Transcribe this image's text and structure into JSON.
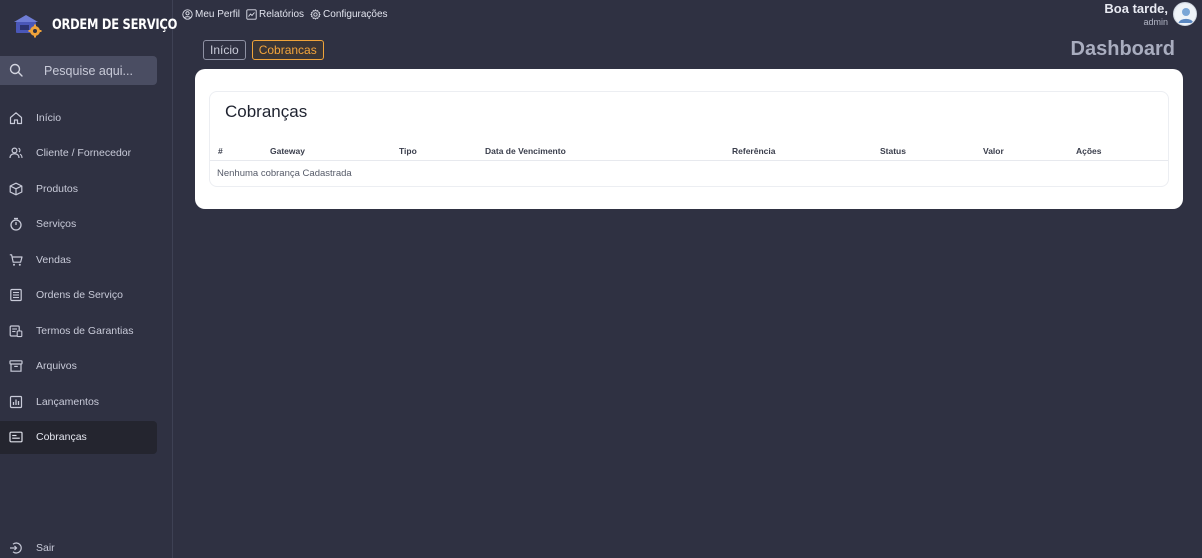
{
  "brand": {
    "title": "ORDEM DE SERVIÇO"
  },
  "search": {
    "placeholder": "Pesquise aqui..."
  },
  "sidebar": {
    "items": [
      {
        "label": "Início",
        "icon": "home-icon"
      },
      {
        "label": "Cliente / Fornecedor",
        "icon": "users-icon"
      },
      {
        "label": "Produtos",
        "icon": "box-icon"
      },
      {
        "label": "Serviços",
        "icon": "stopwatch-icon"
      },
      {
        "label": "Vendas",
        "icon": "cart-icon"
      },
      {
        "label": "Ordens de Serviço",
        "icon": "document-list-icon"
      },
      {
        "label": "Termos de Garantias",
        "icon": "warranty-icon"
      },
      {
        "label": "Arquivos",
        "icon": "archive-icon"
      },
      {
        "label": "Lançamentos",
        "icon": "bar-chart-icon"
      },
      {
        "label": "Cobranças",
        "icon": "billing-icon",
        "active": true
      }
    ],
    "logout": "Sair"
  },
  "topbar": {
    "links": [
      {
        "label": "Meu Perfil",
        "icon": "user-circle-icon"
      },
      {
        "label": "Relatórios",
        "icon": "chart-icon"
      },
      {
        "label": "Configurações",
        "icon": "gear-icon"
      }
    ],
    "greeting": "Boa tarde,",
    "username": "admin"
  },
  "breadcrumb": {
    "home": "Início",
    "current": "Cobrancas"
  },
  "page_heading": "Dashboard",
  "panel": {
    "title": "Cobranças",
    "columns": [
      "#",
      "Gateway",
      "Tipo",
      "Data de Vencimento",
      "Referência",
      "Status",
      "Valor",
      "Ações"
    ],
    "empty_message": "Nenhuma cobrança Cadastrada"
  },
  "colors": {
    "background": "#2f3142",
    "sidebar_active": "#24252f",
    "accent": "#f3a43b",
    "card": "#ffffff"
  }
}
